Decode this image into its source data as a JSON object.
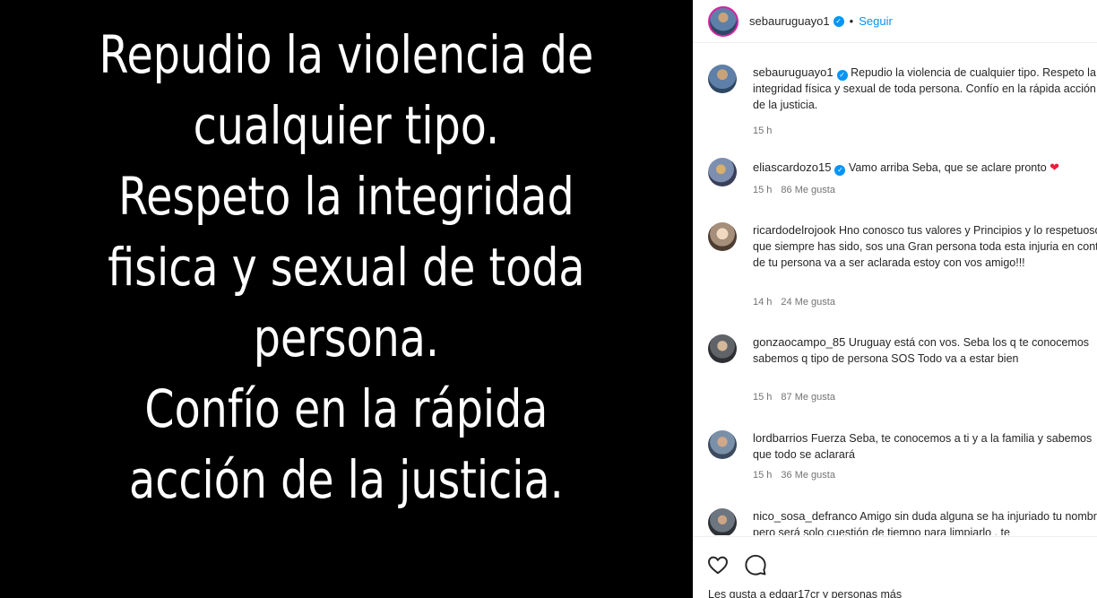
{
  "post": {
    "text_lines": [
      "Repudio la violencia de",
      "cualquier tipo.",
      "Respeto la integridad",
      "fisica y sexual de toda",
      "persona.",
      "Confío en la rápida",
      "acción de la justicia."
    ]
  },
  "header": {
    "username": "sebauruguayo1",
    "separator": "•",
    "follow_label": "Seguir"
  },
  "comments": [
    {
      "username": "sebauruguayo1",
      "verified": true,
      "text": "Repudio la violencia de cualquier tipo. Respeto la integridad física y sexual de toda persona. Confío en la rápida acción de la justicia.",
      "time": "15 h",
      "likes": ""
    },
    {
      "username": "eliascardozo15",
      "verified": true,
      "text": "Vamo arriba Seba, que se aclare pronto",
      "emoji": "❤",
      "time": "15 h",
      "likes": "86 Me gusta"
    },
    {
      "username": "ricardodelrojook",
      "verified": false,
      "text": "Hno conosco tus valores y Principios y lo respetuoso que siempre has sido, sos una Gran persona toda esta injuria en contra de tu persona va a ser aclarada estoy con vos amigo!!!",
      "time": "14 h",
      "likes": "24 Me gusta"
    },
    {
      "username": "gonzaocampo_85",
      "verified": false,
      "text": "Uruguay está con vos. Seba los q te conocemos sabemos q tipo de persona SOS Todo va a estar bien",
      "time": "15 h",
      "likes": "87 Me gusta"
    },
    {
      "username": "lordbarrios",
      "verified": false,
      "text": "Fuerza Seba, te conocemos a ti y a la familia y sabemos que todo se aclarará",
      "time": "15 h",
      "likes": "36 Me gusta"
    },
    {
      "username": "nico_sosa_defranco",
      "verified": false,
      "text": "Amigo sin duda alguna se ha injuriado tu nombre pero será solo cuestión de tiempo para limpiarlo , te",
      "time": "",
      "likes": ""
    }
  ],
  "actions": {
    "likes_line": "Les gusta a edgar17cr y personas más"
  },
  "colors": {
    "accent": "#0095f6",
    "story_ring": "#d6249f",
    "heart": "#ed1c3a"
  }
}
